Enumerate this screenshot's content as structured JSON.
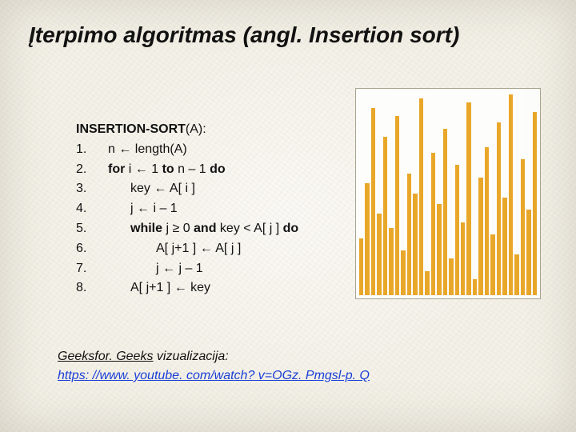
{
  "title": "Įterpimo algoritmas (angl. Insertion sort)",
  "pseudo": {
    "header_b": "INSERTION-SORT",
    "header_plain": "(A):",
    "lines": [
      {
        "num": "1.",
        "indent": 1,
        "parts": [
          {
            "t": "n ← length(A)",
            "b": false
          }
        ]
      },
      {
        "num": "2.",
        "indent": 1,
        "parts": [
          {
            "t": "for",
            "b": true
          },
          {
            "t": " i ← 1 ",
            "b": false
          },
          {
            "t": "to",
            "b": true
          },
          {
            "t": " n – 1 ",
            "b": false
          },
          {
            "t": "do",
            "b": true
          }
        ]
      },
      {
        "num": "3.",
        "indent": 2,
        "parts": [
          {
            "t": "key ← A[ i ]",
            "b": false
          }
        ]
      },
      {
        "num": "4.",
        "indent": 2,
        "parts": [
          {
            "t": "j ← i – 1",
            "b": false
          }
        ]
      },
      {
        "num": "5.",
        "indent": 2,
        "parts": [
          {
            "t": "while",
            "b": true
          },
          {
            "t": " j ≥ 0 ",
            "b": false
          },
          {
            "t": "and",
            "b": true
          },
          {
            "t": " key < A[ j ] ",
            "b": false
          },
          {
            "t": "do",
            "b": true
          }
        ]
      },
      {
        "num": "6.",
        "indent": 3,
        "parts": [
          {
            "t": "A[ j+1 ] ← A[ j ]",
            "b": false
          }
        ]
      },
      {
        "num": "7.",
        "indent": 3,
        "parts": [
          {
            "t": "j ← j – 1",
            "b": false
          }
        ]
      },
      {
        "num": "8.",
        "indent": 2,
        "parts": [
          {
            "t": "A[ j+1 ] ← key",
            "b": false
          }
        ]
      }
    ]
  },
  "chart_data": {
    "type": "bar",
    "title": "",
    "xlabel": "",
    "ylabel": "",
    "ylim": [
      0,
      100
    ],
    "categories": [
      "1",
      "2",
      "3",
      "4",
      "5",
      "6",
      "7",
      "8",
      "9",
      "10",
      "11",
      "12",
      "13",
      "14",
      "15",
      "16",
      "17",
      "18",
      "19",
      "20",
      "21",
      "22",
      "23",
      "24",
      "25",
      "26",
      "27",
      "28",
      "29",
      "30"
    ],
    "values": [
      28,
      55,
      92,
      40,
      78,
      33,
      88,
      22,
      60,
      50,
      97,
      12,
      70,
      45,
      82,
      18,
      64,
      36,
      95,
      8,
      58,
      73,
      30,
      85,
      48,
      99,
      20,
      67,
      42,
      90
    ]
  },
  "footer": {
    "label_prefix": "Geeksfor. Geeks",
    "label_suffix": " vizualizacija:",
    "url_text": "https: //www. youtube. com/watch? v=OGz. Pmgsl-p. Q"
  }
}
